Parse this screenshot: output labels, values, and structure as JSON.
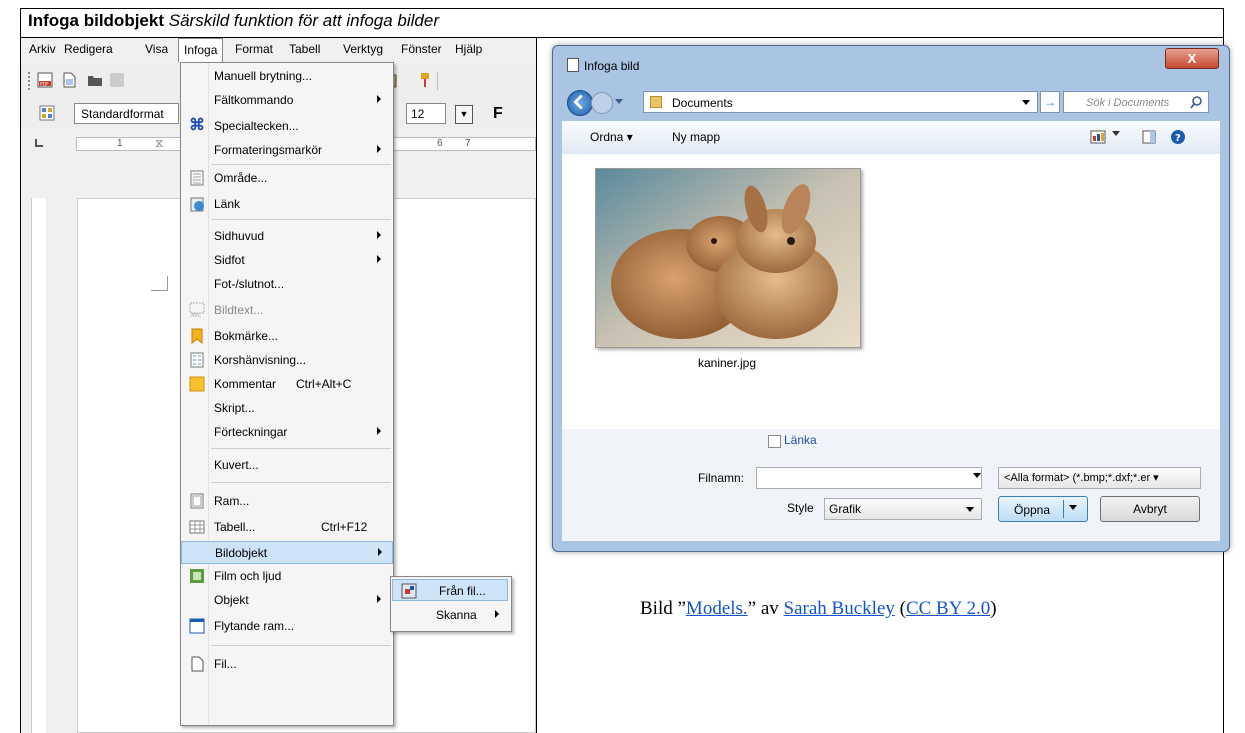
{
  "header": {
    "title_bold": "Infoga bildobjekt",
    "title_italic": "Särskild funktion för att infoga bilder"
  },
  "writer": {
    "menubar": [
      "Arkiv",
      "Redigera",
      "Visa",
      "Infoga",
      "Format",
      "Tabell",
      "Verktyg",
      "Fönster",
      "Hjälp"
    ],
    "paragraph_style": "Standardformat",
    "font_size": "12",
    "bold_label": "F",
    "ruler_marks": [
      "1",
      "6",
      "7"
    ],
    "insert_menu": {
      "items": [
        {
          "label": "Manuell brytning...",
          "has_submenu": false
        },
        {
          "label": "Fältkommando",
          "has_submenu": true
        },
        {
          "label": "Specialtecken...",
          "icon": "special-char-icon",
          "has_submenu": false
        },
        {
          "label": "Formateringsmarkör",
          "has_submenu": true
        },
        {
          "label": "Område...",
          "icon": "section-icon"
        },
        {
          "label": "Länk",
          "icon": "hyperlink-icon"
        },
        {
          "label": "Sidhuvud",
          "has_submenu": true
        },
        {
          "label": "Sidfot",
          "has_submenu": true
        },
        {
          "label": "Fot-/slutnot..."
        },
        {
          "label": "Bildtext...",
          "icon": "caption-icon",
          "disabled": true
        },
        {
          "label": "Bokmärke...",
          "icon": "bookmark-icon"
        },
        {
          "label": "Korshänvisning...",
          "icon": "cross-reference-icon"
        },
        {
          "label": "Kommentar",
          "shortcut": "Ctrl+Alt+C",
          "icon": "comment-icon"
        },
        {
          "label": "Skript..."
        },
        {
          "label": "Förteckningar",
          "has_submenu": true
        },
        {
          "label": "Kuvert..."
        },
        {
          "label": "Ram...",
          "icon": "frame-icon"
        },
        {
          "label": "Tabell...",
          "shortcut": "Ctrl+F12",
          "icon": "table-icon"
        },
        {
          "label": "Bildobjekt",
          "has_submenu": true,
          "highlighted": true
        },
        {
          "label": "Film och ljud",
          "icon": "movie-sound-icon"
        },
        {
          "label": "Objekt",
          "has_submenu": true
        },
        {
          "label": "Flytande ram...",
          "icon": "floating-frame-icon"
        },
        {
          "label": "Fil...",
          "icon": "file-icon"
        }
      ]
    },
    "picture_submenu": {
      "from_file": "Från fil...",
      "scan": "Skanna"
    }
  },
  "dialog": {
    "title": "Infoga bild",
    "close": "X",
    "path": "Documents",
    "search_placeholder": "Sök i Documents",
    "organize": "Ordna",
    "new_folder": "Ny mapp",
    "file_name": "kaniner.jpg",
    "link_label": "Länka",
    "filename_label": "Filnamn:",
    "filename_value": "",
    "format_filter": "<Alla format> (*.bmp;*.dxf;*.er",
    "style_label": "Style",
    "style_value": "Grafik",
    "open_label": "Öppna",
    "cancel_label": "Avbryt"
  },
  "attribution": {
    "prefix": "Bild ”",
    "work": "Models.",
    "by": "” av ",
    "author": "Sarah Buckley",
    "license": "CC BY 2.0"
  },
  "colors": {
    "menu_highlight": "#cde3f8",
    "dialog_frame": "#a9c5e3",
    "link": "#1155cc"
  }
}
